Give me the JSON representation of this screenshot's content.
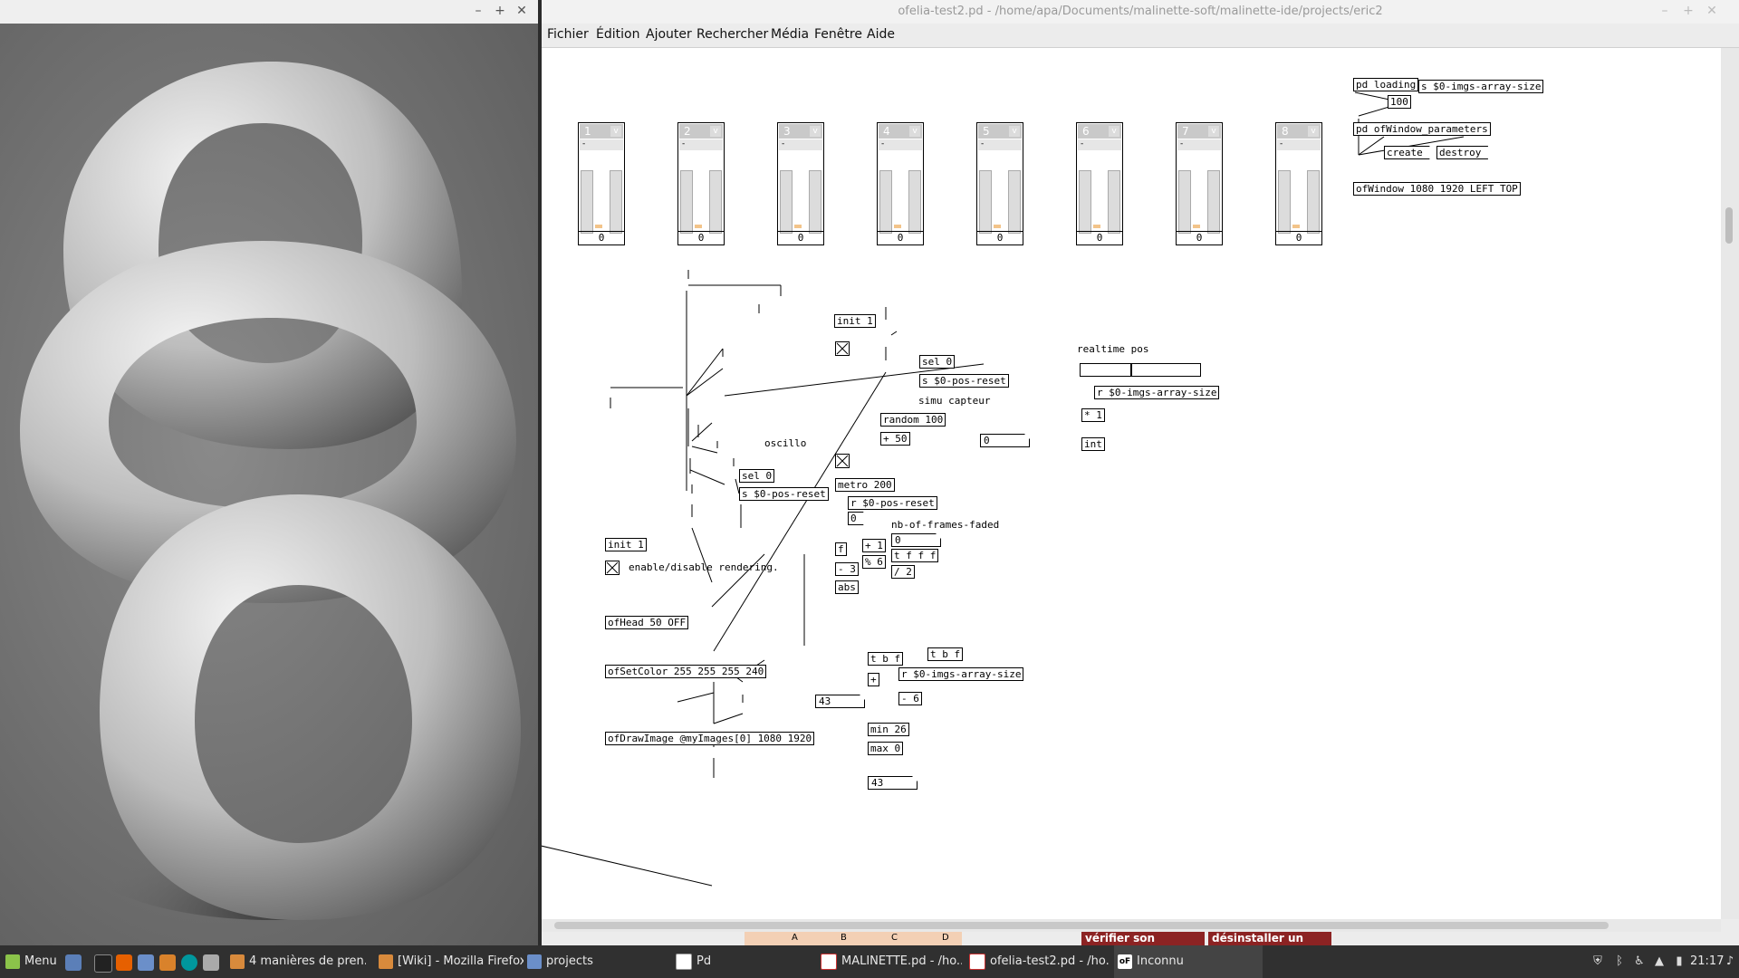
{
  "render_window": {
    "minimize": "–",
    "maximize": "+",
    "close": "✕"
  },
  "pd_window": {
    "title": "ofelia-test2.pd  - /home/apa/Documents/malinette-soft/malinette-ide/projects/eric2",
    "controls": {
      "minimize": "–",
      "maximize": "+",
      "close": "✕"
    },
    "menu": [
      "Fichier",
      "Édition",
      "Ajouter",
      "Rechercher",
      "Média",
      "Fenêtre",
      "Aide"
    ]
  },
  "gop_panels": [
    {
      "num": "1",
      "value": "0"
    },
    {
      "num": "2",
      "value": "0"
    },
    {
      "num": "3",
      "value": "0"
    },
    {
      "num": "4",
      "value": "0"
    },
    {
      "num": "5",
      "value": "0"
    },
    {
      "num": "6",
      "value": "0"
    },
    {
      "num": "7",
      "value": "0"
    },
    {
      "num": "8",
      "value": "0"
    }
  ],
  "gop_common": {
    "v": "v",
    "dash": "-"
  },
  "pd_objects": {
    "pd_loading": "pd loading",
    "s_imgs_size": "s $0-imgs-array-size",
    "msg_100": "100",
    "pd_ofwindow_params": "pd ofWindow_parameters",
    "msg_create": "create",
    "msg_destroy": "destroy",
    "ofwindow": "ofWindow 1080 1920 LEFT TOP",
    "init1_a": "init 1",
    "sel0_a": "sel 0",
    "s_pos_reset_a": "s $0-pos-reset",
    "comment_simu": "simu capteur",
    "random": "random 100",
    "plus50": "+ 50",
    "num_0_a": "0",
    "comment_oscillo": "oscillo",
    "sel0_b": "sel 0",
    "s_pos_reset_b": "s $0-pos-reset",
    "metro": "metro 200",
    "r_pos_reset": "r $0-pos-reset",
    "msg_0": "0",
    "comment_frames": "nb-of-frames-faded",
    "num_0_b": "0",
    "f": "f",
    "plus1": "+ 1",
    "mod6": "% 6",
    "t_fff": "t f f f",
    "minus3": "- 3",
    "div2": "/ 2",
    "abs": "abs",
    "comment_realtime": "realtime pos",
    "r_imgs_size_a": "r $0-imgs-array-size",
    "mul1": "* 1",
    "int": "int",
    "init1_b": "init 1",
    "comment_enable": "enable/disable rendering.",
    "ofhead": "ofHead 50 OFF",
    "ofsetcolor": "ofSetColor 255 255 255 240",
    "ofdrawimage": "ofDrawImage @myImages[0] 1080 1920",
    "t_bf_a": "t b f",
    "t_bf_b": "t b f",
    "plus": "+",
    "r_imgs_size_b": "r $0-imgs-array-size",
    "num_43_a": "43",
    "minus6": "- 6",
    "min26": "min 26",
    "max0": "max 0",
    "num_43_b": "43"
  },
  "behind_window": {
    "spreadsheet_cols": [
      "A",
      "B",
      "C",
      "D"
    ],
    "banner_1": "vérifier son",
    "banner_2": "désinstaller un"
  },
  "taskbar": {
    "menu": "Menu",
    "tasks": [
      {
        "label": "4 manières de pren...",
        "icon": "pinwheel-icon"
      },
      {
        "label": "[Wiki] - Mozilla Firefox",
        "icon": "firefox-icon"
      },
      {
        "label": "projects",
        "icon": "folder-icon"
      },
      {
        "label": "Pd",
        "icon": "pd-icon"
      },
      {
        "label": "MALINETTE.pd - /ho...",
        "icon": "pd-patch-icon"
      },
      {
        "label": "ofelia-test2.pd - /ho...",
        "icon": "pd-patch-icon"
      },
      {
        "label": "Inconnu",
        "icon": "of-icon"
      }
    ],
    "clock": "21:17"
  }
}
